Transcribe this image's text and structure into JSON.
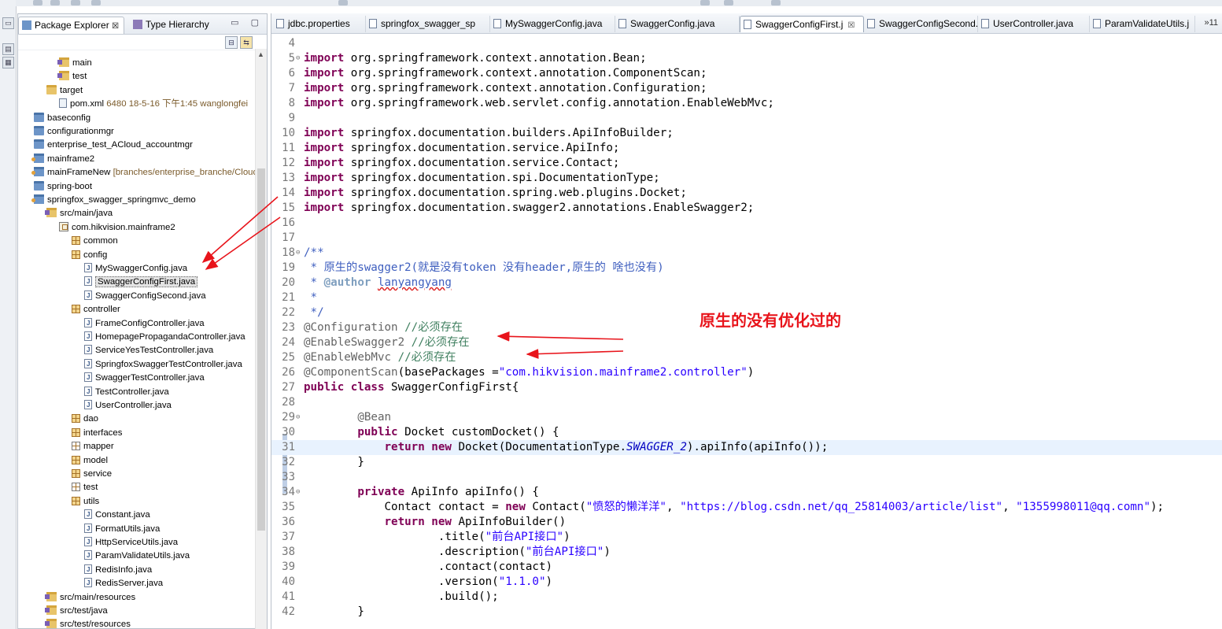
{
  "colors": {
    "keyword": "#7f0055",
    "string": "#2a00ff",
    "javadoc": "#3f5fbf",
    "comment": "#3f7f5f",
    "annotation_mark": "#e8141b"
  },
  "package_explorer": {
    "tabs": [
      {
        "label": "Package Explorer",
        "icon": "package-explorer-icon",
        "close": "☒"
      },
      {
        "label": "Type Hierarchy",
        "icon": "type-hierarchy-icon"
      }
    ],
    "window_buttons": "▭ ▢",
    "tree": [
      {
        "label": "main",
        "icon": "source-folder-icon"
      },
      {
        "label": "test",
        "icon": "source-folder-icon"
      },
      {
        "label": "target",
        "icon": "folder-icon"
      },
      {
        "label": "pom.xml",
        "annotation": "6480  18-5-16 下午1:45  wanglongfei",
        "icon": "xml-file-icon"
      },
      {
        "label": "baseconfig",
        "icon": "project-icon"
      },
      {
        "label": "configurationmgr",
        "icon": "project-icon"
      },
      {
        "label": "enterprise_test_ACloud_accountmgr",
        "icon": "project-icon"
      },
      {
        "label": "mainframe2",
        "icon": "maven-project-icon"
      },
      {
        "label": "mainFrameNew",
        "annotation": "[branches/enterprise_branche/Cloud",
        "icon": "maven-project-icon"
      },
      {
        "label": "spring-boot",
        "icon": "project-icon"
      },
      {
        "label": "springfox_swagger_springmvc_demo",
        "icon": "maven-project-icon"
      },
      {
        "label": "src/main/java",
        "icon": "source-folder-icon"
      },
      {
        "label": "com.hikvision.mainframe2",
        "icon": "package-root-icon"
      },
      {
        "label": "common",
        "icon": "package-icon"
      },
      {
        "label": "config",
        "icon": "package-icon"
      },
      {
        "label": "MySwaggerConfig.java",
        "icon": "java-file-icon"
      },
      {
        "label": "SwaggerConfigFirst.java",
        "icon": "java-file-icon"
      },
      {
        "label": "SwaggerConfigSecond.java",
        "icon": "java-file-icon"
      },
      {
        "label": "controller",
        "icon": "package-icon"
      },
      {
        "label": "FrameConfigController.java",
        "icon": "java-file-icon"
      },
      {
        "label": "HomepagePropagandaController.java",
        "icon": "java-file-icon"
      },
      {
        "label": "ServiceYesTestController.java",
        "icon": "java-file-icon"
      },
      {
        "label": "SpringfoxSwaggerTestController.java",
        "icon": "java-file-icon"
      },
      {
        "label": "SwaggerTestController.java",
        "icon": "java-file-icon"
      },
      {
        "label": "TestController.java",
        "icon": "java-file-icon"
      },
      {
        "label": "UserController.java",
        "icon": "java-file-icon"
      },
      {
        "label": "dao",
        "icon": "package-icon"
      },
      {
        "label": "interfaces",
        "icon": "package-icon"
      },
      {
        "label": "mapper",
        "icon": "empty-package-icon"
      },
      {
        "label": "model",
        "icon": "package-icon"
      },
      {
        "label": "service",
        "icon": "package-icon"
      },
      {
        "label": "test",
        "icon": "empty-package-icon"
      },
      {
        "label": "utils",
        "icon": "package-icon"
      },
      {
        "label": "Constant.java",
        "icon": "java-file-icon"
      },
      {
        "label": "FormatUtils.java",
        "icon": "java-file-icon"
      },
      {
        "label": "HttpServiceUtils.java",
        "icon": "java-file-icon"
      },
      {
        "label": "ParamValidateUtils.java",
        "icon": "java-file-icon"
      },
      {
        "label": "RedisInfo.java",
        "icon": "java-file-icon"
      },
      {
        "label": "RedisServer.java",
        "icon": "java-file-icon"
      },
      {
        "label": "src/main/resources",
        "icon": "source-folder-icon"
      },
      {
        "label": "src/test/java",
        "icon": "source-folder-icon"
      },
      {
        "label": "src/test/resources",
        "icon": "source-folder-icon"
      }
    ]
  },
  "editor": {
    "tabs": [
      {
        "label": "jdbc.properties"
      },
      {
        "label": "springfox_swagger_sp"
      },
      {
        "label": "MySwaggerConfig.java"
      },
      {
        "label": "SwaggerConfig.java"
      },
      {
        "label": "SwaggerConfigFirst.j",
        "close": "☒"
      },
      {
        "label": "SwaggerConfigSecond."
      },
      {
        "label": "UserController.java"
      },
      {
        "label": "ParamValidateUtils.j"
      }
    ],
    "overflow": "»11",
    "line_numbers": [
      "4",
      "5",
      "6",
      "7",
      "8",
      "9",
      "10",
      "11",
      "12",
      "13",
      "14",
      "15",
      "16",
      "17",
      "18",
      "19",
      "20",
      "21",
      "22",
      "23",
      "24",
      "25",
      "26",
      "27",
      "28",
      "29",
      "30",
      "31",
      "32",
      "33",
      "34",
      "35",
      "36",
      "37",
      "38",
      "39",
      "40",
      "41",
      "42"
    ],
    "code": {
      "l5": "import",
      "l5b": " org.springframework.context.annotation.Bean;",
      "l6": "import",
      "l6b": " org.springframework.context.annotation.ComponentScan;",
      "l7": "import",
      "l7b": " org.springframework.context.annotation.Configuration;",
      "l8": "import",
      "l8b": " org.springframework.web.servlet.config.annotation.EnableWebMvc;",
      "l10": "import",
      "l10b": " springfox.documentation.builders.ApiInfoBuilder;",
      "l11": "import",
      "l11b": " springfox.documentation.service.ApiInfo;",
      "l12": "import",
      "l12b": " springfox.documentation.service.Contact;",
      "l13": "import",
      "l13b": " springfox.documentation.spi.DocumentationType;",
      "l14": "import",
      "l14b": " springfox.documentation.spring.web.plugins.Docket;",
      "l15": "import",
      "l15b": " springfox.documentation.swagger2.annotations.EnableSwagger2;",
      "l18": "/**",
      "l19": " * 原生的swagger2(就是没有token 没有header,原生的 啥也没有)",
      "l20a": " * ",
      "l20b": "@author",
      "l20c": " ",
      "l20d": "lanyangyang",
      "l21": " *",
      "l22": " */",
      "l23a": "@Configuration",
      "l23b": " //必须存在",
      "l24a": "@EnableSwagger2",
      "l24b": " //必须存在",
      "l25a": "@EnableWebMvc",
      "l25b": " //必须存在",
      "l26a": "@ComponentScan",
      "l26b": "(basePackages =",
      "l26c": "\"com.hikvision.mainframe2.controller\"",
      "l26d": ")",
      "l27a": "public",
      "l27b": " ",
      "l27c": "class",
      "l27d": " SwaggerConfigFirst{",
      "l29": "        @Bean",
      "l30a": "        ",
      "l30b": "public",
      "l30c": " Docket customDocket() {",
      "l31a": "            ",
      "l31b": "return",
      "l31c": " ",
      "l31d": "new",
      "l31e": " Docket(DocumentationType.",
      "l31f": "SWAGGER_2",
      "l31g": ").apiInfo(apiInfo());",
      "l32": "        }",
      "l34a": "        ",
      "l34b": "private",
      "l34c": " ApiInfo apiInfo() {",
      "l35a": "            Contact contact = ",
      "l35b": "new",
      "l35c": " Contact(",
      "l35d": "\"愤怒的懒洋洋\"",
      "l35e": ", ",
      "l35f": "\"https://blog.csdn.net/qq_25814003/article/list\"",
      "l35g": ", ",
      "l35h": "\"1355998011@qq.comn\"",
      "l35i": ");",
      "l36a": "            ",
      "l36b": "return",
      "l36c": " ",
      "l36d": "new",
      "l36e": " ApiInfoBuilder()",
      "l37a": "                    .title(",
      "l37b": "\"前台API接口\"",
      "l37c": ")",
      "l38a": "                    .description(",
      "l38b": "\"前台API接口\"",
      "l38c": ")",
      "l39": "                    .contact(contact)",
      "l40a": "                    .version(",
      "l40b": "\"1.1.0\"",
      "l40c": ")",
      "l41": "                    .build();",
      "l42": "        }"
    },
    "annotation_note": "原生的没有优化过的"
  }
}
